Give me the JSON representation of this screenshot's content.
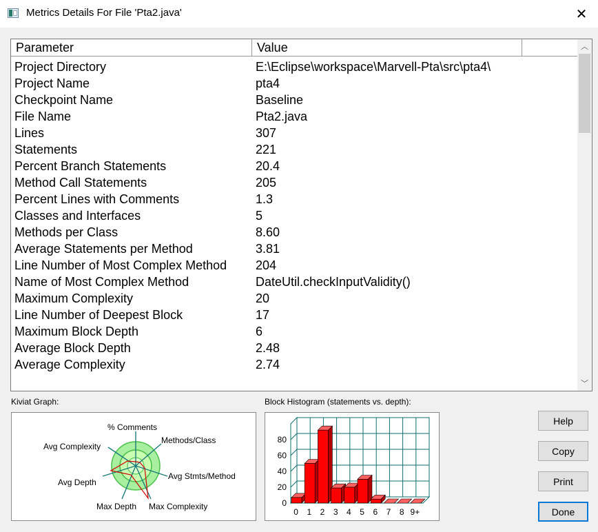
{
  "window": {
    "title": "Metrics Details For File 'Pta2.java'",
    "close_glyph": "✕"
  },
  "table": {
    "columns": [
      "Parameter",
      "Value"
    ],
    "rows": [
      {
        "parameter": "Project Directory",
        "value": "E:\\Eclipse\\workspace\\Marvell-Pta\\src\\pta4\\"
      },
      {
        "parameter": "Project Name",
        "value": "pta4"
      },
      {
        "parameter": "Checkpoint Name",
        "value": "Baseline"
      },
      {
        "parameter": "File Name",
        "value": "Pta2.java"
      },
      {
        "parameter": "Lines",
        "value": "307"
      },
      {
        "parameter": "Statements",
        "value": "221"
      },
      {
        "parameter": "Percent Branch Statements",
        "value": "20.4"
      },
      {
        "parameter": "Method Call Statements",
        "value": "205"
      },
      {
        "parameter": "Percent Lines with Comments",
        "value": "1.3"
      },
      {
        "parameter": "Classes and Interfaces",
        "value": "5"
      },
      {
        "parameter": "Methods per Class",
        "value": "8.60"
      },
      {
        "parameter": "Average Statements per Method",
        "value": "3.81"
      },
      {
        "parameter": "Line Number of Most Complex Method",
        "value": "204"
      },
      {
        "parameter": "Name of Most Complex Method",
        "value": "DateUtil.checkInputValidity()"
      },
      {
        "parameter": "Maximum Complexity",
        "value": "20"
      },
      {
        "parameter": "Line Number of Deepest Block",
        "value": "17"
      },
      {
        "parameter": "Maximum Block Depth",
        "value": "6"
      },
      {
        "parameter": "Average Block Depth",
        "value": "2.48"
      },
      {
        "parameter": "Average Complexity",
        "value": "2.74"
      }
    ]
  },
  "kiviat": {
    "label": "Kiviat Graph:",
    "axes": [
      "% Comments",
      "Methods/Class",
      "Avg Stmts/Method",
      "Max Complexity",
      "Max Depth",
      "Avg Depth",
      "Avg Complexity"
    ]
  },
  "histogram": {
    "label": "Block Histogram (statements vs. depth):",
    "chart_data": {
      "type": "bar",
      "categories": [
        "0",
        "1",
        "2",
        "3",
        "4",
        "5",
        "6",
        "7",
        "8",
        "9+"
      ],
      "values": [
        7,
        50,
        92,
        19,
        20,
        30,
        5,
        0,
        0,
        0
      ],
      "yticks": [
        0,
        20,
        40,
        60,
        80
      ],
      "ylim": [
        0,
        100
      ],
      "bar_color": "#ff0000",
      "grid_color": "#0f6e6e"
    }
  },
  "buttons": {
    "help": "Help",
    "copy": "Copy",
    "print": "Print",
    "done": "Done"
  },
  "colors": {
    "bar": "#ff0000",
    "grid": "#0f6e6e",
    "kiviat_fill": "#a8f0a0",
    "kiviat_ring": "#48c048"
  }
}
